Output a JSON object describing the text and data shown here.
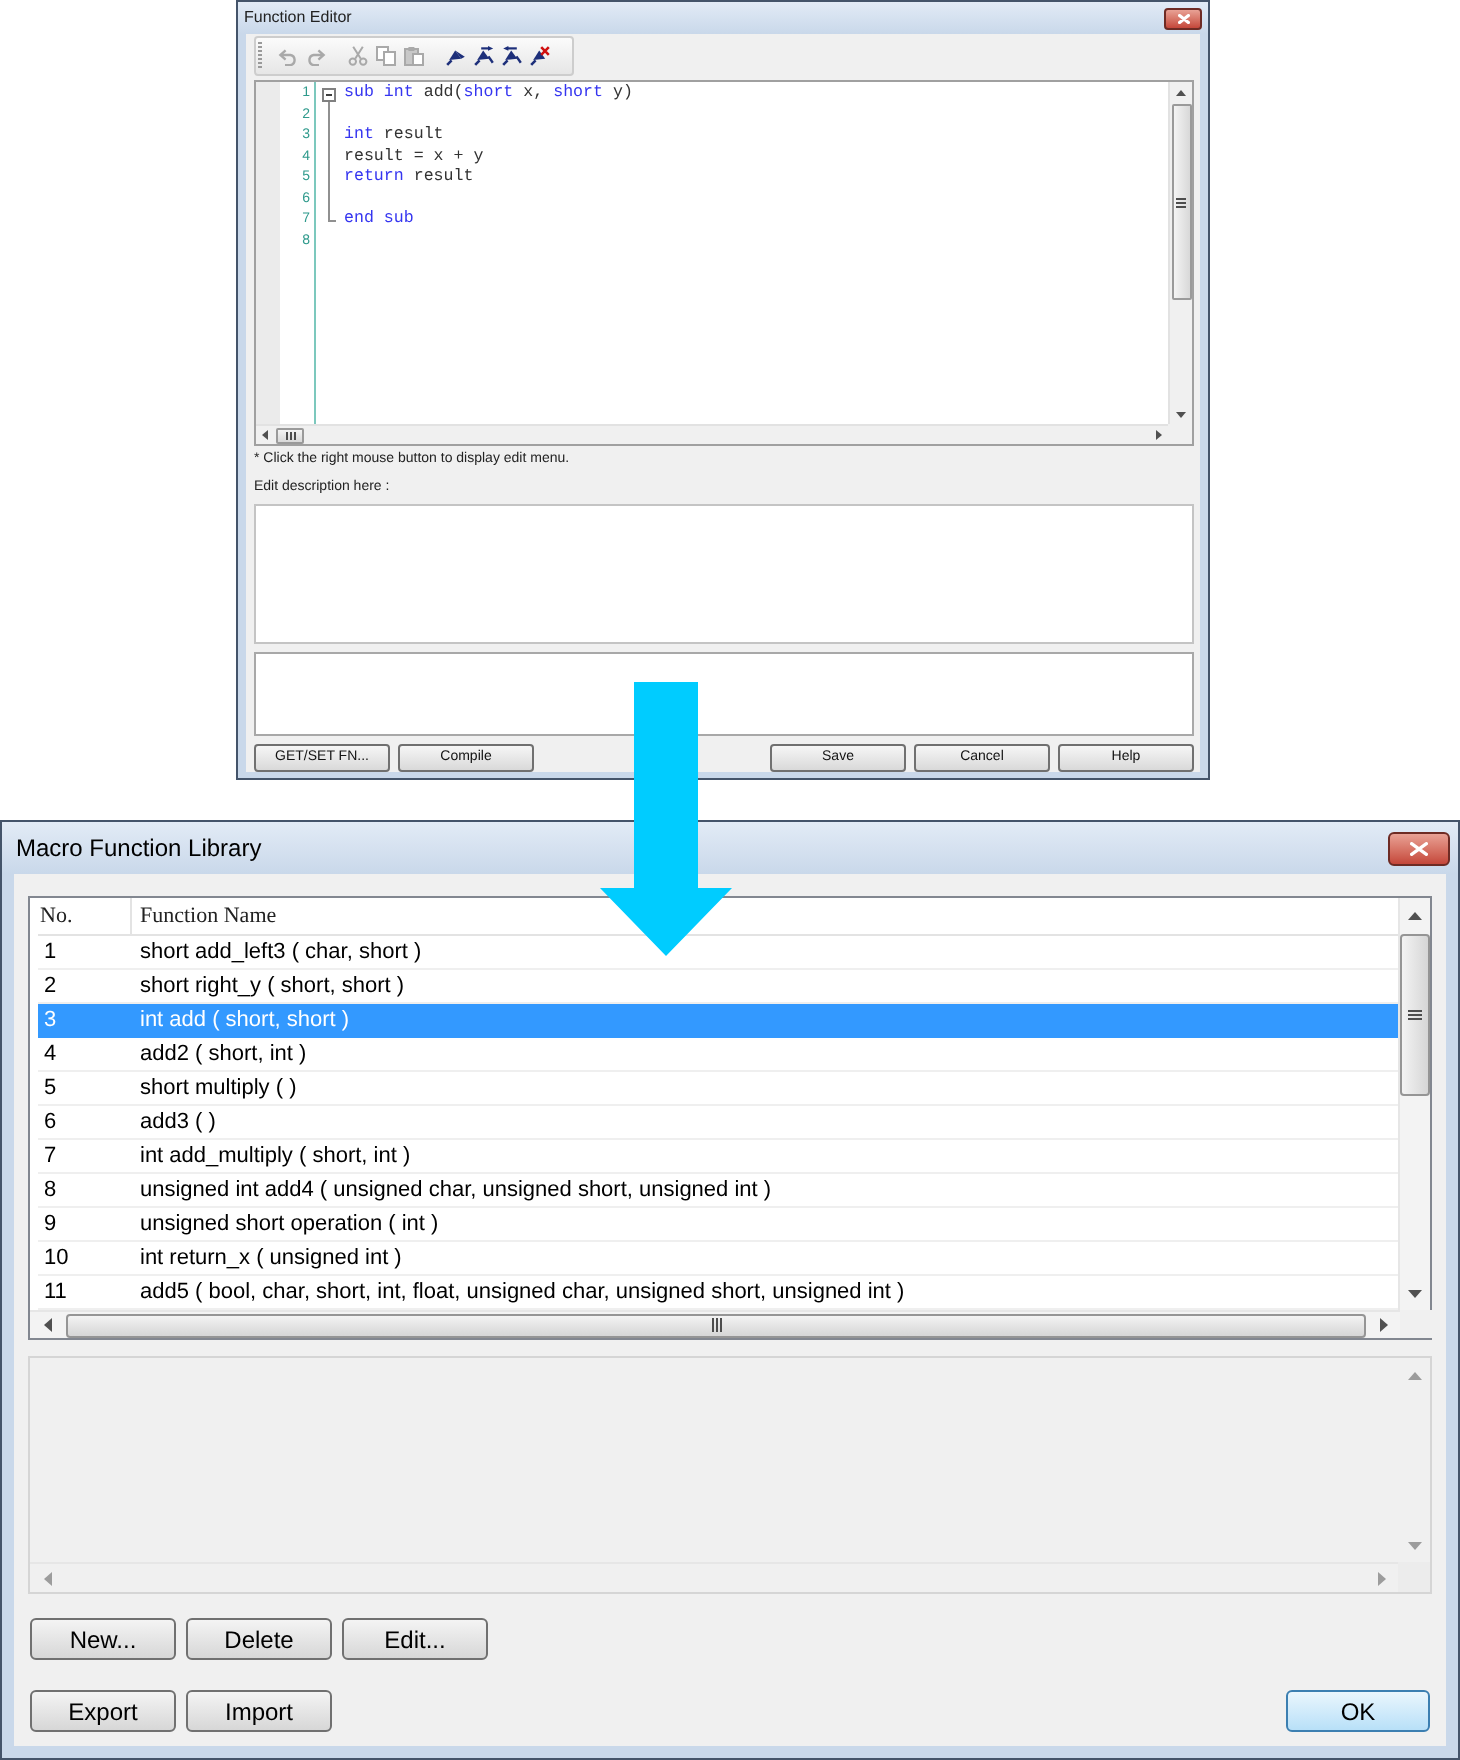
{
  "function_editor": {
    "title": "Function Editor",
    "toolbar_groups": [
      {
        "items": [
          {
            "kind": "undo",
            "disabled": true
          },
          {
            "kind": "redo",
            "disabled": true
          }
        ]
      },
      {
        "items": [
          {
            "kind": "cut",
            "disabled": true
          },
          {
            "kind": "copy",
            "disabled": true
          },
          {
            "kind": "paste",
            "disabled": true
          }
        ]
      },
      {
        "items": [
          {
            "kind": "flag",
            "disabled": false
          },
          {
            "kind": "flag_next",
            "disabled": false
          },
          {
            "kind": "flag_previous",
            "disabled": false
          },
          {
            "kind": "flag_clear",
            "disabled": false
          }
        ]
      }
    ],
    "code_lines": [
      {
        "number": "1",
        "kind": "fold_start",
        "tokens": [
          {
            "text": "sub int",
            "kind": "keyword"
          },
          {
            "text": " add(",
            "kind": "plain"
          },
          {
            "text": "short",
            "kind": "keyword"
          },
          {
            "text": " x, ",
            "kind": "plain"
          },
          {
            "text": "short",
            "kind": "keyword"
          },
          {
            "text": " y)",
            "kind": "plain"
          }
        ]
      },
      {
        "number": "2",
        "kind": "fold_body"
      },
      {
        "number": "3",
        "kind": "fold_body",
        "tokens": [
          {
            "text": "int",
            "kind": "keyword"
          },
          {
            "text": " result",
            "kind": "plain"
          }
        ]
      },
      {
        "number": "4",
        "kind": "fold_body",
        "tokens": [
          {
            "text": "result = x + y",
            "kind": "plain"
          }
        ]
      },
      {
        "number": "5",
        "kind": "fold_body",
        "tokens": [
          {
            "text": "return",
            "kind": "keyword"
          },
          {
            "text": " result",
            "kind": "plain"
          }
        ]
      },
      {
        "number": "6",
        "kind": "fold_body"
      },
      {
        "number": "7",
        "kind": "fold_end",
        "tokens": [
          {
            "text": "end sub",
            "kind": "keyword"
          }
        ]
      },
      {
        "number": "8",
        "kind": "plain"
      }
    ],
    "hint": "* Click the right mouse button to display edit menu.",
    "description_label": "Edit description here :",
    "left_buttons": [
      "GET/SET FN...",
      "Compile"
    ],
    "right_buttons": [
      "Save",
      "Cancel",
      "Help"
    ]
  },
  "macro_library": {
    "title": "Macro Function Library",
    "columns": [
      "No.",
      "Function Name"
    ],
    "rows": [
      {
        "no": "1",
        "function_name": "short add_left3 ( char, short )",
        "selected": false
      },
      {
        "no": "2",
        "function_name": "short right_y ( short, short )",
        "selected": false
      },
      {
        "no": "3",
        "function_name": "int add ( short, short )",
        "selected": true
      },
      {
        "no": "4",
        "function_name": "add2 ( short, int )",
        "selected": false
      },
      {
        "no": "5",
        "function_name": "short multiply ( )",
        "selected": false
      },
      {
        "no": "6",
        "function_name": "add3 ( )",
        "selected": false
      },
      {
        "no": "7",
        "function_name": "int add_multiply ( short, int )",
        "selected": false
      },
      {
        "no": "8",
        "function_name": "unsigned int add4 ( unsigned char, unsigned short, unsigned int )",
        "selected": false
      },
      {
        "no": "9",
        "function_name": "unsigned short operation ( int )",
        "selected": false
      },
      {
        "no": "10",
        "function_name": "int return_x ( unsigned int )",
        "selected": false
      },
      {
        "no": "11",
        "function_name": "add5 ( bool, char, short, int, float, unsigned char, unsigned short, unsigned int )",
        "selected": false
      }
    ],
    "action_buttons": [
      "New...",
      "Delete",
      "Edit..."
    ],
    "file_buttons": [
      "Export",
      "Import"
    ],
    "ok_button": {
      "label": "OK",
      "default": true
    }
  }
}
